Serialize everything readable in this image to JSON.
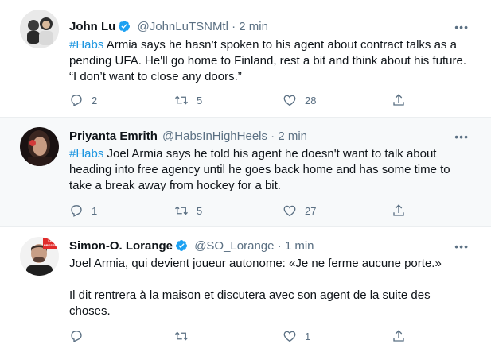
{
  "tweets": [
    {
      "name": "John Lu",
      "handle": "@JohnLuTSNMtl",
      "sep": "·",
      "time": "2 min",
      "verified": true,
      "hashtag": "#Habs",
      "text": " Armia says he hasn’t spoken to his agent about contract talks as a pending UFA. He'll go home to Finland, rest a bit and think about his future. “I don’t want to close any doors.”",
      "replies": "2",
      "retweets": "5",
      "likes": "28"
    },
    {
      "name": "Priyanta Emrith",
      "handle": "@HabsInHighHeels",
      "sep": "·",
      "time": "2 min",
      "verified": false,
      "hashtag": "#Habs",
      "text": " Joel Armia says he told his agent he doesn't want to talk about heading into free agency until he goes back home and has some time to take a break away from hockey for a bit.",
      "replies": "1",
      "retweets": "5",
      "likes": "27"
    },
    {
      "name": "Simon-O. Lorange",
      "handle": "@SO_Lorange",
      "sep": "·",
      "time": "1 min",
      "verified": true,
      "text_line1": "Joel Armia, qui devient joueur autonome: «Je ne ferme aucune porte.»",
      "text_line2": "Il dit rentrera à la maison et discutera avec son agent de la suite des choses.",
      "replies": "",
      "retweets": "",
      "likes": "1",
      "avatar_badge": "LA PRESSE"
    }
  ],
  "more_label": "•••",
  "colors": {
    "accent": "#1da1f2",
    "hashtag": "#1b95e0",
    "muted": "#5b7083",
    "highlight_bg": "#f7f9fa"
  },
  "icons": [
    "verified-badge-icon",
    "reply-icon",
    "retweet-icon",
    "like-icon",
    "share-icon",
    "more-icon"
  ]
}
